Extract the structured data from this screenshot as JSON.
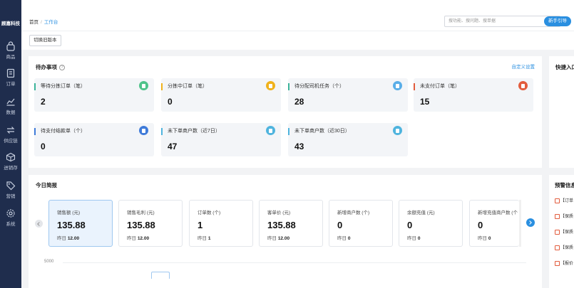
{
  "brand": "顾嘉科技",
  "sidebar": {
    "items": [
      {
        "label": "商品"
      },
      {
        "label": "订单"
      },
      {
        "label": "数据"
      },
      {
        "label": "供应链"
      },
      {
        "label": "进销存"
      },
      {
        "label": "营销"
      },
      {
        "label": "系统"
      }
    ]
  },
  "breadcrumb": {
    "home": "首页",
    "current": "工作台"
  },
  "search": {
    "placeholder": "搜功能、搜问题、搜单据"
  },
  "guide_button": "新手引导",
  "switch_button": "切换旧版本",
  "todo": {
    "title": "待办事项",
    "custom_link": "自定义设置",
    "cards": [
      {
        "label": "等待分拣订单（笔）",
        "value": "2",
        "color": "#3cb49a"
      },
      {
        "label": "分拣中订单（笔）",
        "value": "0",
        "color": "#f0b21c"
      },
      {
        "label": "待分配司机任务（个）",
        "value": "28",
        "color": "#3cb49a"
      },
      {
        "label": "未支付订单（笔）",
        "value": "15",
        "color": "#e25c3d"
      },
      {
        "label": "待支付结款单（个）",
        "value": "0",
        "color": "#3f7bd9"
      },
      {
        "label": "未下单商户数（近7日）",
        "value": "47",
        "color": "#4fb4de"
      },
      {
        "label": "未下单商户数（近30日）",
        "value": "43",
        "color": "#4fb4de"
      }
    ],
    "icon_colors": [
      "#4fc38a",
      "#f0b21c",
      "#5aaee8",
      "#e25c3d",
      "#3f7bd9",
      "#4fb4de",
      "#4fb4de"
    ]
  },
  "quick": {
    "title": "快捷入口"
  },
  "report": {
    "title": "今日简报",
    "y_tick": "5000",
    "stats": [
      {
        "label": "销售额 (元)",
        "value": "135.88",
        "prev_label": "昨日",
        "prev": "12.00"
      },
      {
        "label": "销售毛利 (元)",
        "value": "135.88",
        "prev_label": "昨日",
        "prev": "12.00"
      },
      {
        "label": "订单数 (个)",
        "value": "1",
        "prev_label": "昨日",
        "prev": "1"
      },
      {
        "label": "客单价 (元)",
        "value": "135.88",
        "prev_label": "昨日",
        "prev": "12.00"
      },
      {
        "label": "新增商户数 (个)",
        "value": "0",
        "prev_label": "昨日",
        "prev": "0"
      },
      {
        "label": "余额充值 (元)",
        "value": "0",
        "prev_label": "昨日",
        "prev": "0"
      },
      {
        "label": "新增充值商户数 (个",
        "value": "0",
        "prev_label": "昨日",
        "prev": "0"
      }
    ]
  },
  "warn": {
    "title": "预警信息",
    "items": [
      "【订单",
      "【保质",
      "【保质",
      "【保质",
      "【报价"
    ]
  }
}
